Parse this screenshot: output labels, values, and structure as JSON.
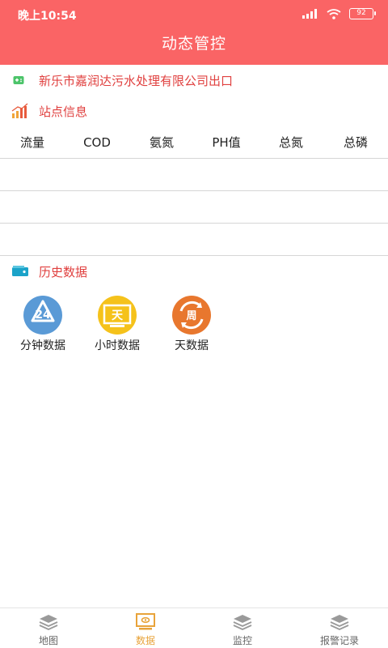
{
  "status_bar": {
    "time": "晚上10:54",
    "battery": "92"
  },
  "header": {
    "title": "动态管控"
  },
  "site": {
    "name": "新乐市嘉润达污水处理有限公司出口"
  },
  "station_info": {
    "title": "站点信息",
    "columns": [
      "流量",
      "COD",
      "氨氮",
      "PH值",
      "总氮",
      "总磷"
    ]
  },
  "history": {
    "title": "历史数据",
    "items": [
      {
        "label": "分钟数据",
        "badge": "24",
        "color": "#5a9ad6"
      },
      {
        "label": "小时数据",
        "badge": "天",
        "color": "#f5c21b"
      },
      {
        "label": "天数据",
        "badge": "周",
        "color": "#e8772e"
      }
    ]
  },
  "tabs": [
    {
      "label": "地图",
      "icon": "layers-icon",
      "active": false
    },
    {
      "label": "数据",
      "icon": "monitor-icon",
      "active": true
    },
    {
      "label": "监控",
      "icon": "layers-icon",
      "active": false
    },
    {
      "label": "报警记录",
      "icon": "layers-icon",
      "active": false
    }
  ],
  "colors": {
    "primary": "#fa6465",
    "accent_text": "#e0403f",
    "active_tab": "#e8a33a"
  }
}
